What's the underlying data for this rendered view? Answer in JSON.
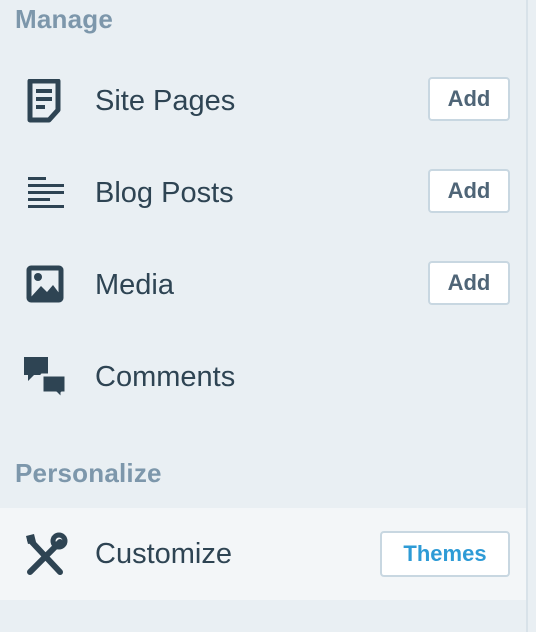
{
  "sections": {
    "manage": {
      "heading": "Manage"
    },
    "personalize": {
      "heading": "Personalize"
    }
  },
  "items": {
    "site_pages": {
      "label": "Site Pages",
      "action": "Add",
      "icon": "page-icon"
    },
    "blog_posts": {
      "label": "Blog Posts",
      "action": "Add",
      "icon": "posts-icon"
    },
    "media": {
      "label": "Media",
      "action": "Add",
      "icon": "image-icon"
    },
    "comments": {
      "label": "Comments",
      "icon": "comments-icon"
    },
    "customize": {
      "label": "Customize",
      "action": "Themes",
      "icon": "tools-icon",
      "selected": true
    }
  },
  "colors": {
    "background": "#e9eff3",
    "selected_background": "#f3f6f8",
    "heading": "#7d97ab",
    "label": "#2e4453",
    "icon": "#2e4453",
    "button_border": "#c8d7e1",
    "themes_accent": "#2e9bd6"
  }
}
